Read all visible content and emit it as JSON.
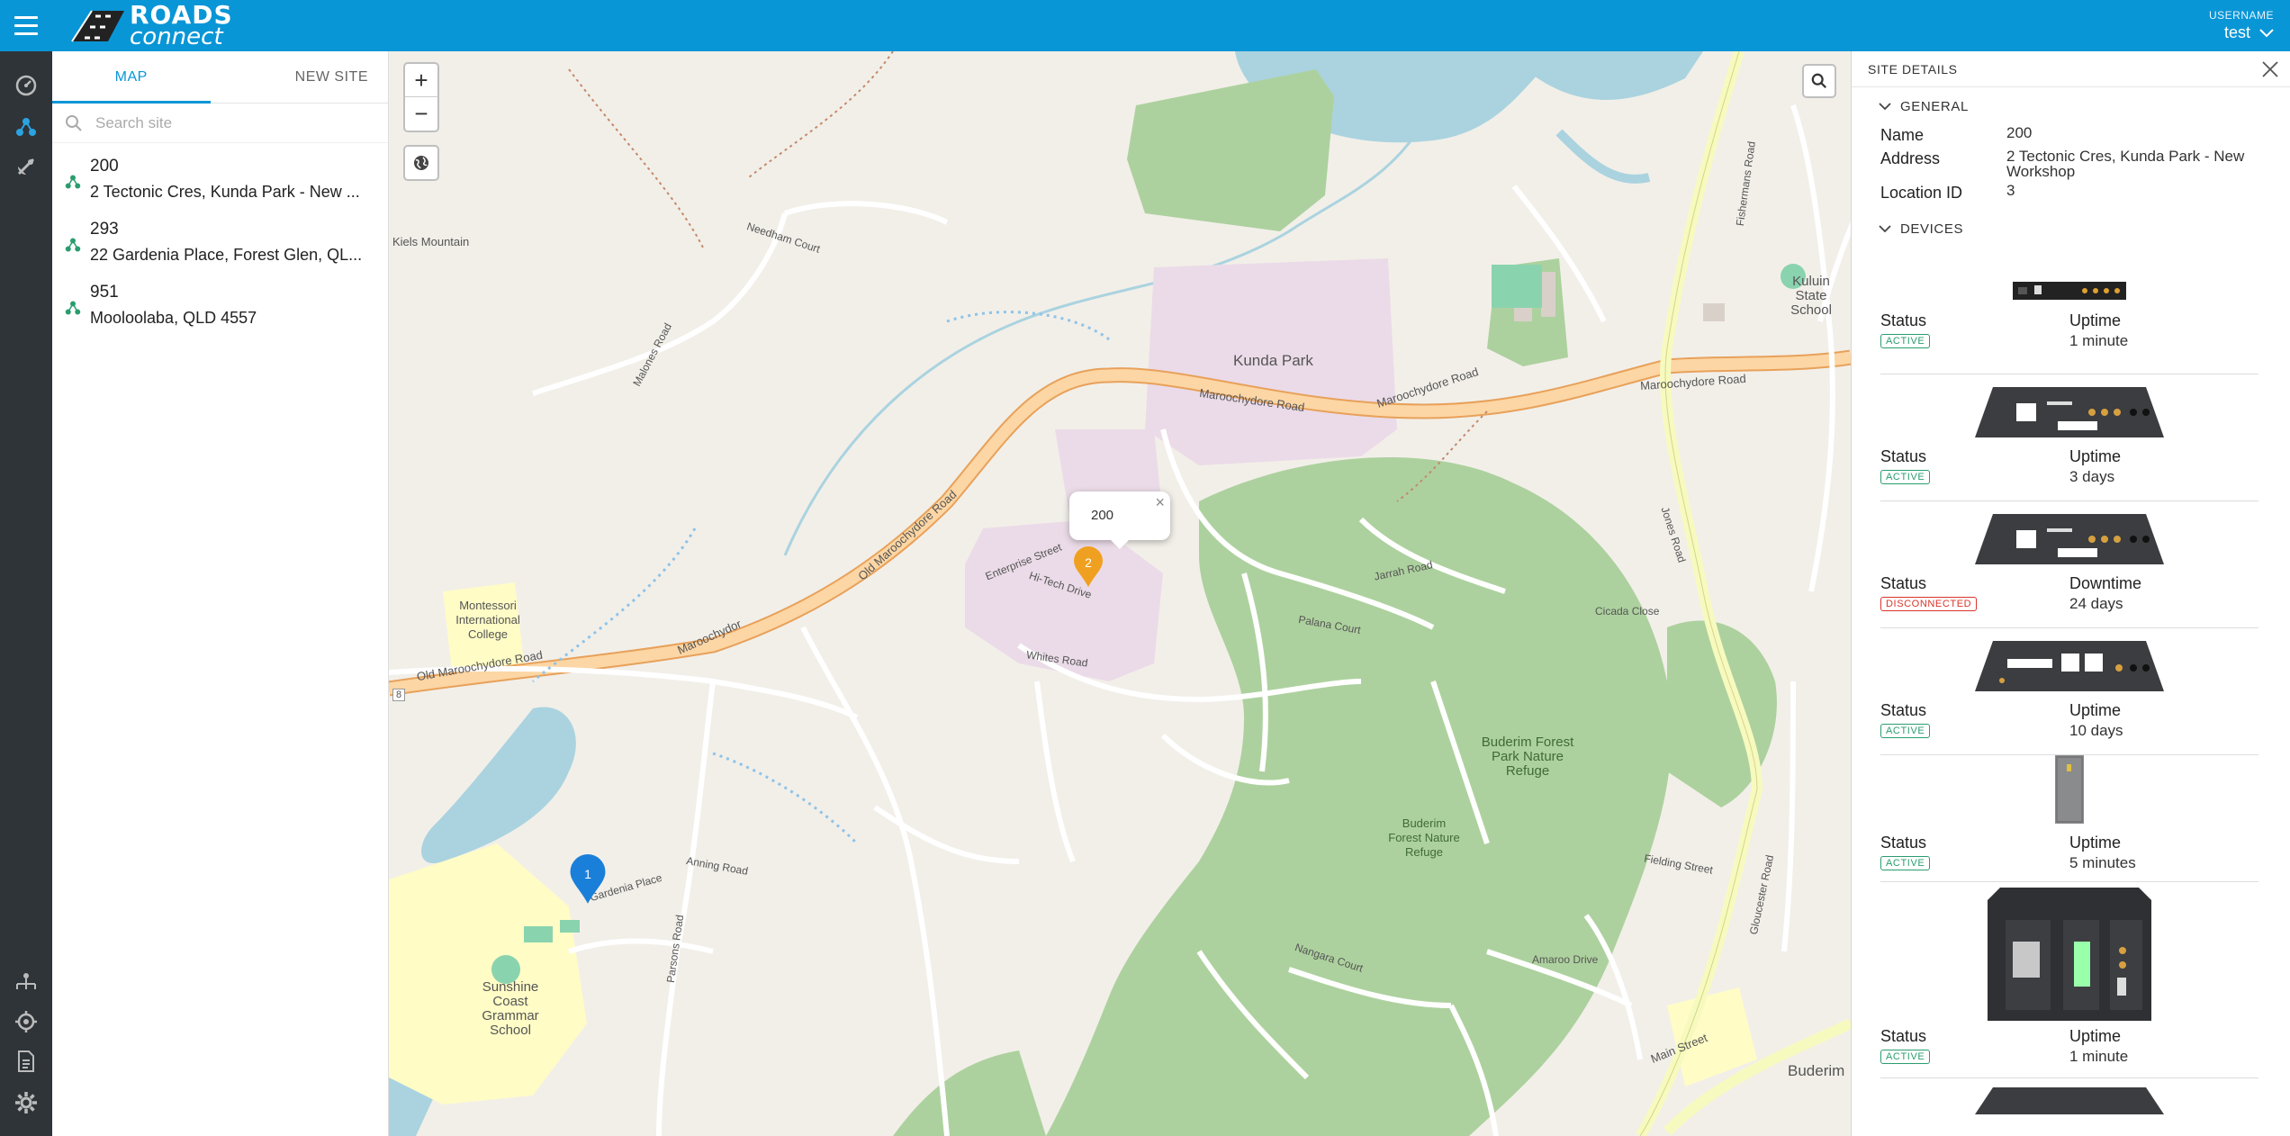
{
  "app": {
    "logo_line1": "ROADS",
    "logo_line2": "connect",
    "user_label": "USERNAME",
    "user_name": "test",
    "brand_color": "#0996d6"
  },
  "rail": {
    "items": [
      "dashboard-icon",
      "sites-icon",
      "satellite-dish-icon",
      "network-icon",
      "location-target-icon",
      "document-icon",
      "gear-icon"
    ]
  },
  "panel": {
    "tabs": [
      {
        "label": "MAP"
      },
      {
        "label": "NEW SITE"
      }
    ],
    "search_placeholder": "Search site",
    "sites": [
      {
        "id": "200",
        "address": "2 Tectonic Cres, Kunda Park - New ..."
      },
      {
        "id": "293",
        "address": "22 Gardenia Place, Forest Glen, QL..."
      },
      {
        "id": "951",
        "address": "Mooloolaba, QLD 4557"
      }
    ]
  },
  "map": {
    "popup_text": "200",
    "popup_close": "×",
    "markers": [
      {
        "label": "2",
        "color": "#f0a020"
      },
      {
        "label": "1",
        "color": "#1a7fd9"
      }
    ],
    "labels": {
      "kunda_park": "Kunda Park",
      "maroochydore_road": "Maroochydore Road",
      "maroochydore_road_2": "Maroochydore Road",
      "maroochydore_road_3": "Maroochydore Road",
      "maroochydor": "Maroochydor",
      "old_maroochydore_road": "Old Maroochydore Road",
      "old_maroochydore_road_2": "Old Maroochydore Road",
      "kiels_mountain": "Kiels Mountain",
      "montessori": "Montessori International College",
      "sunshine_coast": "Sunshine Coast Grammar School",
      "buderim_forest_park": "Buderim Forest Park Nature Refuge",
      "buderim_forest_nature": "Buderim Forest Nature Refuge",
      "buderim": "Buderim",
      "kuluin": "Kuluin State School",
      "main_street": "Main Street",
      "whites_road": "Whites Road",
      "enterprise_street": "Enterprise Street",
      "hi_tech_drive": "Hi-Tech Drive",
      "jarrah_road": "Jarrah Road",
      "fishermans_road": "Fishermans Road",
      "jones_road": "Jones Road",
      "gloucester_road": "Gloucester Road",
      "anning_road": "Anning Road",
      "gardenia_place": "Gardenia Place",
      "parsons_road": "Parsons Road",
      "malones_road": "Malones Road",
      "needham_court": "Needham Court",
      "cicada_close": "Cicada Close",
      "palana_court": "Palana Court",
      "amaroo_drive": "Amaroo Drive",
      "nangara_court": "Nangara Court",
      "fielding_street": "Fielding Street",
      "route_8": "8"
    }
  },
  "details": {
    "title": "SITE DETAILS",
    "general_label": "GENERAL",
    "name_label": "Name",
    "name_value": "200",
    "address_label": "Address",
    "address_value": "2 Tectonic Cres, Kunda Park - New Workshop",
    "location_label": "Location ID",
    "location_value": "3",
    "devices_label": "DEVICES",
    "status_label": "Status",
    "devices": [
      {
        "status": "ACTIVE",
        "metric": "Uptime",
        "value": "1 minute"
      },
      {
        "status": "ACTIVE",
        "metric": "Uptime",
        "value": "3 days"
      },
      {
        "status": "DISCONNECTED",
        "metric": "Downtime",
        "value": "24 days"
      },
      {
        "status": "ACTIVE",
        "metric": "Uptime",
        "value": "10 days"
      },
      {
        "status": "ACTIVE",
        "metric": "Uptime",
        "value": "5 minutes"
      },
      {
        "status": "ACTIVE",
        "metric": "Uptime",
        "value": "1 minute"
      }
    ]
  }
}
